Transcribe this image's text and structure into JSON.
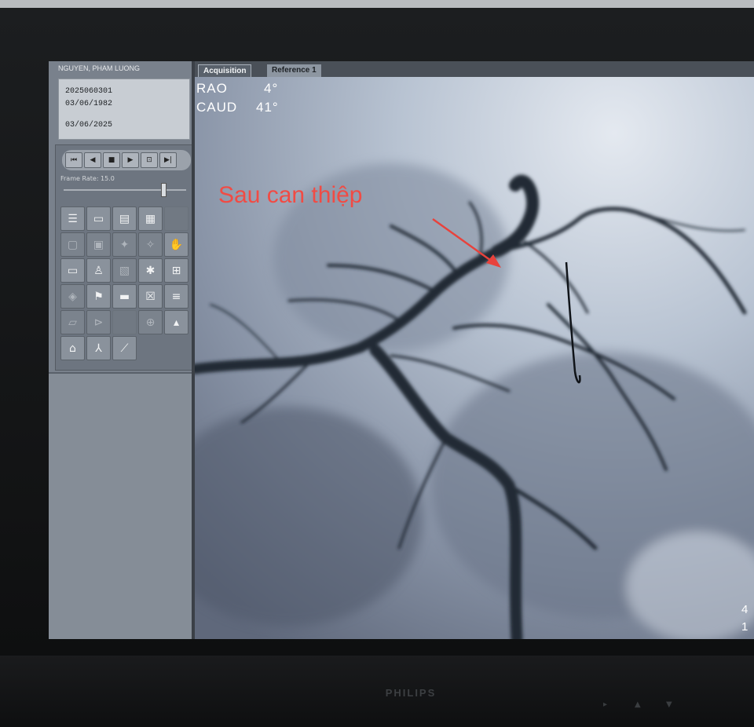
{
  "monitor": {
    "brand": "PHILIPS"
  },
  "patient": {
    "name": "NGUYEN, PHAM LUONG",
    "id": "2025060301",
    "birth_date": "03/06/1982",
    "study_date": "03/06/2025"
  },
  "playback": {
    "frame_rate_label": "Frame Rate: 15.0",
    "buttons": [
      "⏮",
      "◀",
      "■",
      "▶",
      "⊡",
      "▶|"
    ]
  },
  "tools": {
    "icons": [
      "list-icon",
      "folder-icon",
      "film-icon",
      "grid-icon",
      "",
      "display-icon",
      "monitor-icon",
      "star-icon",
      "star-outline-icon",
      "hand-icon",
      "screen-icon",
      "person-icon",
      "layers-icon",
      "spider-icon",
      "reference-icon",
      "rotate-icon",
      "flag-icon",
      "window-icon",
      "close-box-icon",
      "database-icon",
      "ruler-icon",
      "mirror-icon",
      "",
      "zoom-icon",
      "stack-icon",
      "erase-icon",
      "branch-icon",
      "caliper-icon",
      "",
      ""
    ]
  },
  "tabs": [
    {
      "label": "Acquisition",
      "active": true
    },
    {
      "label": "Reference 1",
      "active": false
    }
  ],
  "view": {
    "angle1_label": "RAO",
    "angle1_value": "4°",
    "angle2_label": "CAUD",
    "angle2_value": "41°",
    "edge_digit_1": "4",
    "edge_digit_2": "1"
  },
  "annotation": {
    "text": "Sau can thiệp",
    "color": "#f14b44"
  }
}
